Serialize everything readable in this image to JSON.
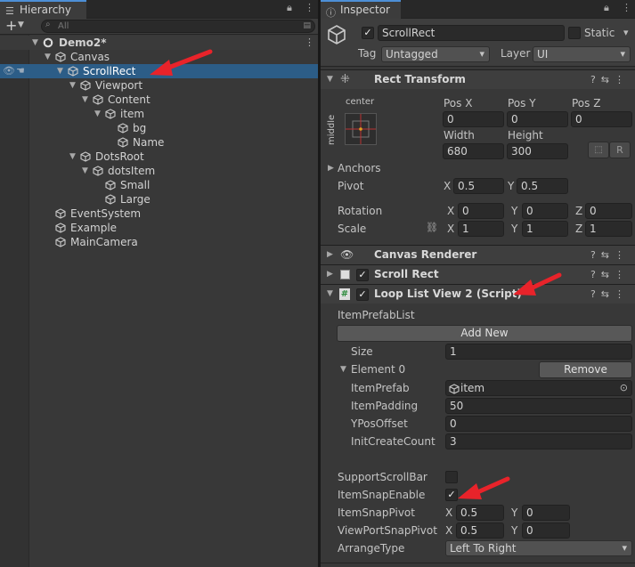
{
  "hierarchy": {
    "tab_label": "Hierarchy",
    "add_label": "+",
    "search_placeholder": "All",
    "items": [
      {
        "label": "Demo2*"
      },
      {
        "label": "Canvas"
      },
      {
        "label": "ScrollRect"
      },
      {
        "label": "Viewport"
      },
      {
        "label": "Content"
      },
      {
        "label": "item"
      },
      {
        "label": "bg"
      },
      {
        "label": "Name"
      },
      {
        "label": "DotsRoot"
      },
      {
        "label": "dotsItem"
      },
      {
        "label": "Small"
      },
      {
        "label": "Large"
      },
      {
        "label": "EventSystem"
      },
      {
        "label": "Example"
      },
      {
        "label": "MainCamera"
      }
    ]
  },
  "inspector": {
    "tab_label": "Inspector",
    "object_name": "ScrollRect",
    "static_label": "Static",
    "tag_label": "Tag",
    "tag_value": "Untagged",
    "layer_label": "Layer",
    "layer_value": "UI",
    "rect_transform": {
      "title": "Rect Transform",
      "anchor_h": "center",
      "anchor_v": "middle",
      "posx_label": "Pos X",
      "posx": "0",
      "posy_label": "Pos Y",
      "posy": "0",
      "posz_label": "Pos Z",
      "posz": "0",
      "width_label": "Width",
      "width": "680",
      "height_label": "Height",
      "height": "300",
      "r_button": "R",
      "anchors_label": "Anchors",
      "pivot_label": "Pivot",
      "pivot_x": "0.5",
      "pivot_y": "0.5",
      "rotation_label": "Rotation",
      "rot_x": "0",
      "rot_y": "0",
      "rot_z": "0",
      "scale_label": "Scale",
      "scale_x": "1",
      "scale_y": "1",
      "scale_z": "1",
      "x": "X",
      "y": "Y",
      "z": "Z"
    },
    "canvas_renderer": {
      "title": "Canvas Renderer"
    },
    "scroll_rect": {
      "title": "Scroll Rect"
    },
    "loop_list": {
      "title": "Loop List View 2 (Script)",
      "item_prefab_list": "ItemPrefabList",
      "add_new": "Add New",
      "size_label": "Size",
      "size": "1",
      "element_label": "Element 0",
      "remove": "Remove",
      "item_prefab_label": "ItemPrefab",
      "item_prefab": "item",
      "item_padding_label": "ItemPadding",
      "item_padding": "50",
      "ypos_offset_label": "YPosOffset",
      "ypos_offset": "0",
      "init_count_label": "InitCreateCount",
      "init_count": "3",
      "support_scrollbar_label": "SupportScrollBar",
      "snap_enable_label": "ItemSnapEnable",
      "snap_pivot_label": "ItemSnapPivot",
      "snap_pivot_x": "0.5",
      "snap_pivot_y": "0",
      "viewport_snap_label": "ViewPortSnapPivot",
      "viewport_snap_x": "0.5",
      "viewport_snap_y": "0",
      "arrange_label": "ArrangeType",
      "arrange": "Left To Right"
    }
  },
  "colors": {
    "selection": "#2c5d87",
    "accent_tab": "#4d8fd6",
    "annotation": "#e8232a"
  }
}
